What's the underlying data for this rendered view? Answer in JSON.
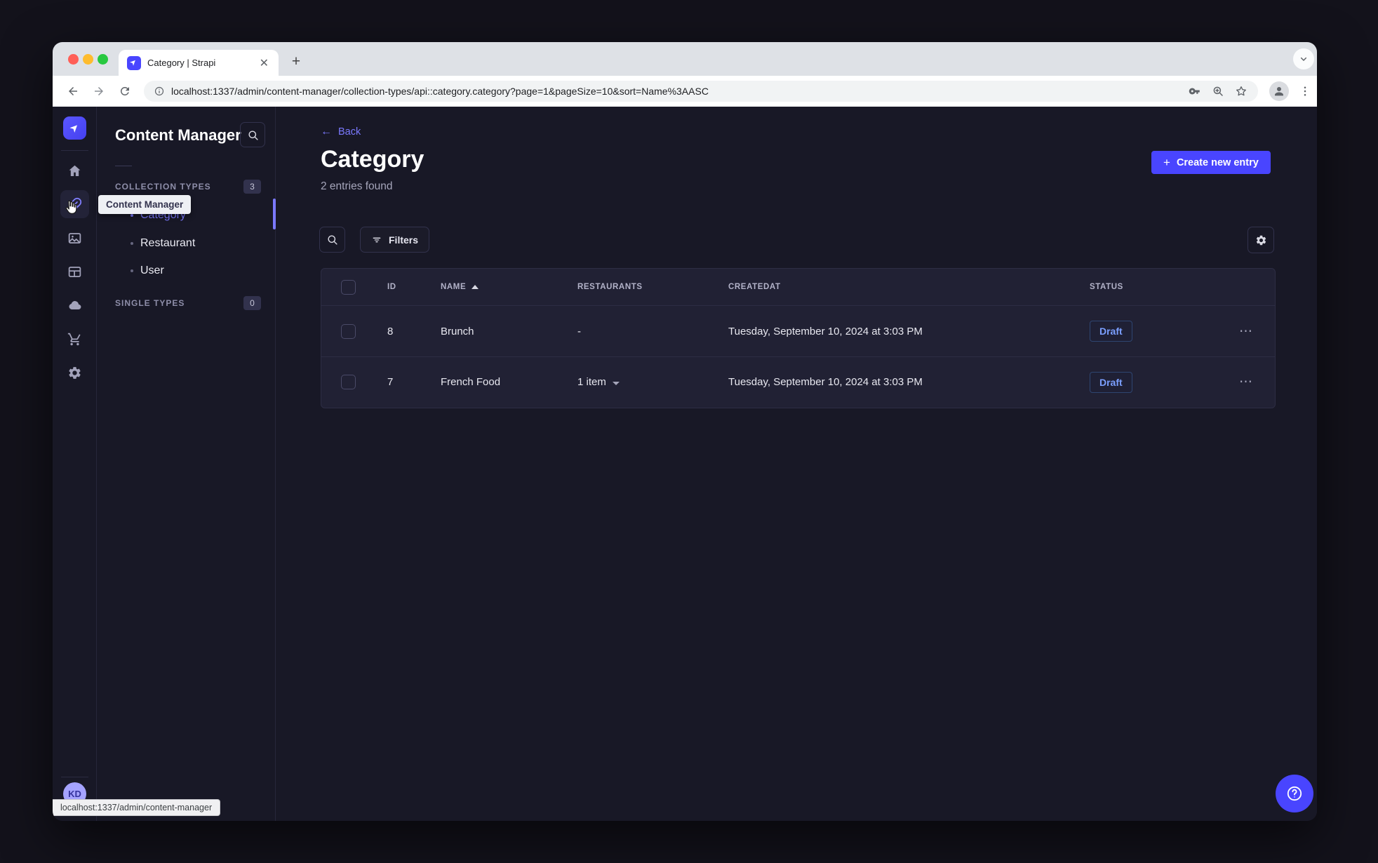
{
  "browser": {
    "tab_title": "Category | Strapi",
    "url": "localhost:1337/admin/content-manager/collection-types/api::category.category?page=1&pageSize=10&sort=Name%3AASC",
    "status_bar": "localhost:1337/admin/content-manager"
  },
  "sidebar": {
    "icons": [
      "home-icon",
      "content-manager-icon",
      "media-library-icon",
      "content-type-builder-icon",
      "cloud-icon",
      "marketplace-icon",
      "settings-icon"
    ],
    "active_icon": "content-manager-icon",
    "tooltip": "Content Manager",
    "user_initials": "KD"
  },
  "subnav": {
    "title": "Content Manager",
    "sections": [
      {
        "label": "COLLECTION TYPES",
        "count": "3",
        "items": [
          {
            "label": "Category",
            "active": true
          },
          {
            "label": "Restaurant",
            "active": false
          },
          {
            "label": "User",
            "active": false
          }
        ]
      },
      {
        "label": "SINGLE TYPES",
        "count": "0",
        "items": []
      }
    ]
  },
  "main": {
    "back_label": "Back",
    "title": "Category",
    "subtitle": "2 entries found",
    "create_button_label": "Create new entry",
    "filters_label": "Filters",
    "table": {
      "headers": [
        "ID",
        "NAME",
        "RESTAURANTS",
        "CREATEDAT",
        "STATUS"
      ],
      "sorted_by": "NAME",
      "sort_direction": "asc",
      "rows": [
        {
          "id": "8",
          "name": "Brunch",
          "restaurants": "-",
          "createdAt": "Tuesday, September 10, 2024 at 3:03 PM",
          "status": "Draft"
        },
        {
          "id": "7",
          "name": "French Food",
          "restaurants": "1 item",
          "createdAt": "Tuesday, September 10, 2024 at 3:03 PM",
          "status": "Draft"
        }
      ]
    }
  },
  "colors": {
    "accent": "#4945ff",
    "link": "#7b79ff",
    "draft_text": "#7b9fff",
    "app_background": "#181826",
    "panel_background": "#212134"
  }
}
